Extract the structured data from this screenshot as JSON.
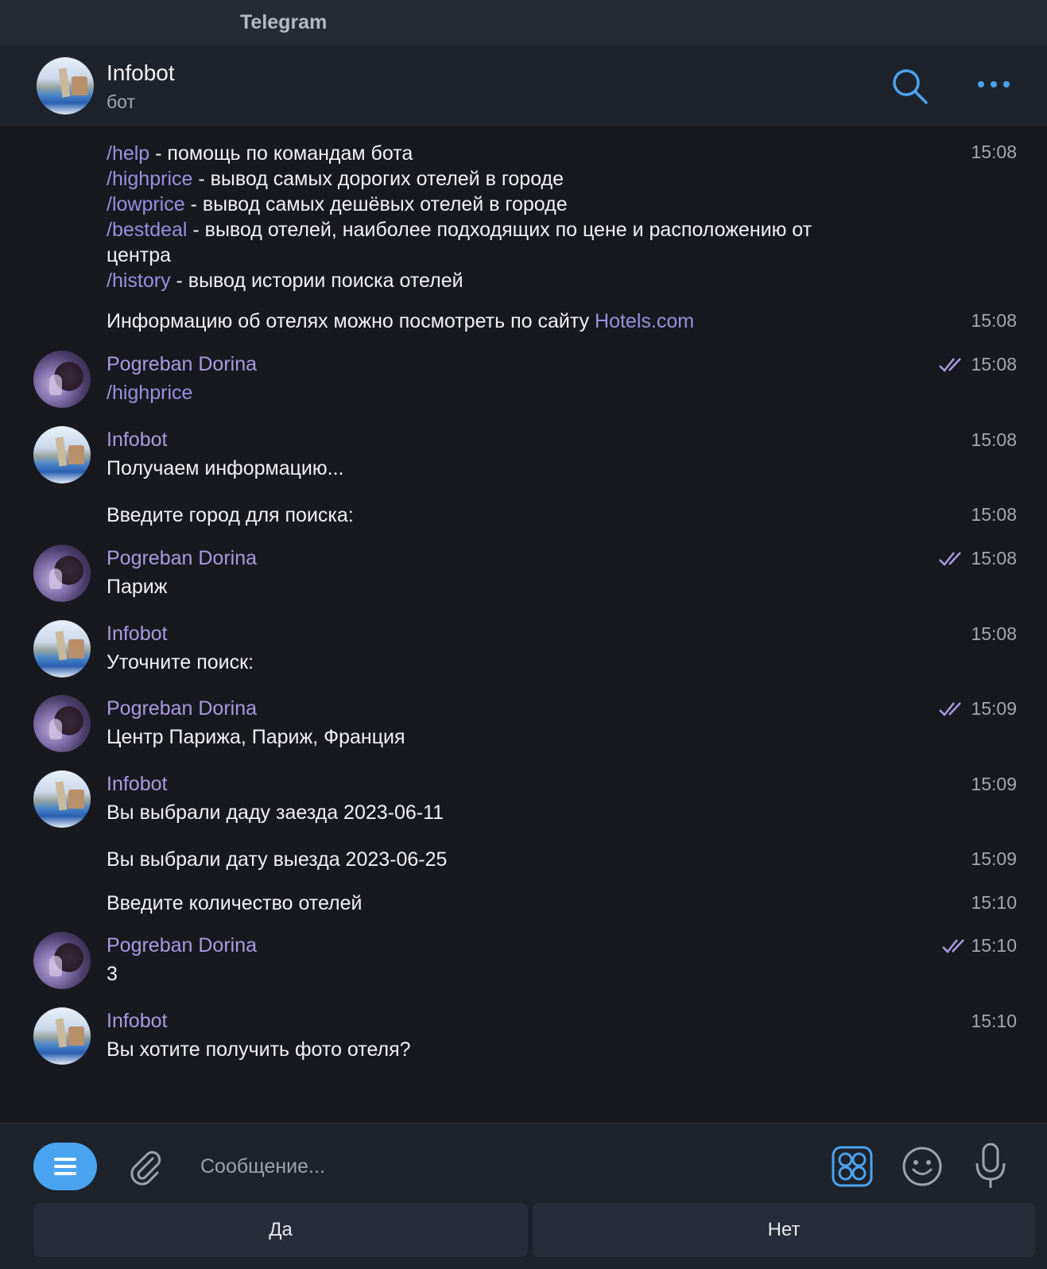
{
  "window": {
    "title": "Telegram"
  },
  "header": {
    "name": "Infobot",
    "status": "бот"
  },
  "colors": {
    "accent": "#4aa3f0",
    "sender": "#a89be0",
    "link": "#9b8fe0",
    "background": "#18181f",
    "panel": "#1e222b"
  },
  "messages": [
    {
      "lines": [
        {
          "cmd": "/help",
          "rest": " - помощь по командам бота"
        },
        {
          "cmd": "/highprice",
          "rest": " - вывод самых дорогих отелей в городе"
        },
        {
          "cmd": "/lowprice",
          "rest": " - вывод самых дешёвых отелей в городе"
        },
        {
          "cmd": "/bestdeal",
          "rest": " - вывод отелей, наиболее подходящих по цене и расположению от"
        },
        {
          "cmd": "",
          "rest": "центра"
        },
        {
          "cmd": "/history",
          "rest": " - вывод истории поиска отелей"
        }
      ],
      "time": "15:08"
    },
    {
      "text": "Информацию об отелях можно посмотреть по сайту ",
      "link": "Hotels.com",
      "time": "15:08"
    },
    {
      "sender": "Pogreban Dorina",
      "cmd": "/highprice",
      "time": "15:08",
      "read": true
    },
    {
      "sender": "Infobot",
      "text": "Получаем информацию...",
      "time": "15:08"
    },
    {
      "text": "Введите город для поиска:",
      "time": "15:08"
    },
    {
      "sender": "Pogreban Dorina",
      "text": "Париж",
      "time": "15:08",
      "read": true
    },
    {
      "sender": "Infobot",
      "text": "Уточните поиск:",
      "time": "15:08"
    },
    {
      "sender": "Pogreban Dorina",
      "text": "Центр Парижа, Париж, Франция",
      "time": "15:09",
      "read": true
    },
    {
      "sender": "Infobot",
      "text": "Вы выбрали даду заезда 2023-06-11",
      "time": "15:09"
    },
    {
      "text": "Вы выбрали дату выезда 2023-06-25",
      "time": "15:09"
    },
    {
      "text": "Введите количество отелей",
      "time": "15:10"
    },
    {
      "sender": "Pogreban Dorina",
      "text": "3",
      "time": "15:10",
      "read": true
    },
    {
      "sender": "Infobot",
      "text": "Вы хотите получить фото отеля?",
      "time": "15:10"
    }
  ],
  "composer": {
    "placeholder": "Сообщение...",
    "value": ""
  },
  "keyboard": {
    "yes": "Да",
    "no": "Нет"
  },
  "icons": {
    "search": "search-icon",
    "more": "more-icon",
    "menu": "menu-icon",
    "attach": "paperclip-icon",
    "commands": "bot-commands-icon",
    "emoji": "emoji-icon",
    "mic": "microphone-icon",
    "read": "double-check-icon"
  }
}
